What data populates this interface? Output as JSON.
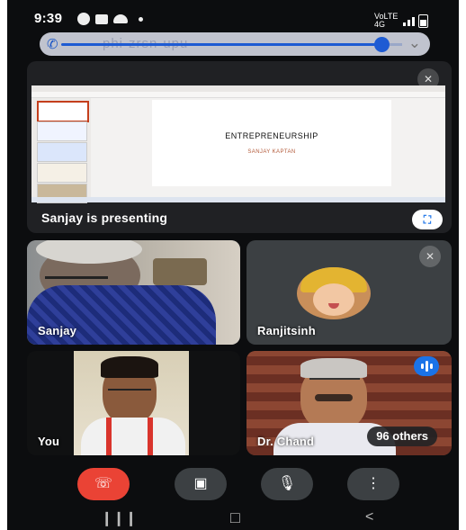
{
  "status_bar": {
    "time": "9:39",
    "network_label": "VoLTE 4G"
  },
  "volume_overlay": {
    "faded_text": "phi-zrsn-upu",
    "level": 0.96
  },
  "presentation": {
    "slide_title": "ENTREPRENEURSHIP",
    "slide_subtitle": "SANJAY KAPTAN",
    "caption": "Sanjay is presenting"
  },
  "participants": [
    {
      "name": "Sanjay",
      "muted": false
    },
    {
      "name": "Ranjitsinh",
      "muted": true
    },
    {
      "name": "You",
      "muted": false
    },
    {
      "name": "Dr. Chand",
      "muted": false,
      "speaking": true
    }
  ],
  "others_badge": "96 others",
  "colors": {
    "end_call": "#ea4335",
    "accent": "#1a73e8",
    "background": "#0c0d0f"
  },
  "icons": {
    "end_call": "phone-hangup-icon",
    "camera": "videocam-icon",
    "mic": "mic-icon",
    "more": "more-vert-icon",
    "mute": "mic-off-icon",
    "fullscreen": "fullscreen-icon"
  }
}
